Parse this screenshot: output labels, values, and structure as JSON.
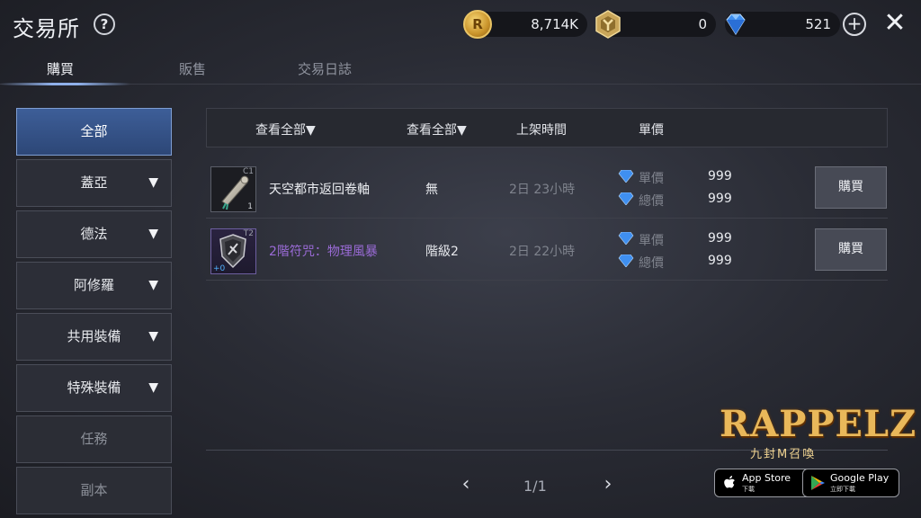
{
  "header": {
    "title": "交易所",
    "help_glyph": "?",
    "close_glyph": "✕",
    "plus_glyph": "+"
  },
  "currencies": [
    {
      "icon": "r-coin-icon",
      "value": "8,714K"
    },
    {
      "icon": "hex-badge-icon",
      "value": "0"
    },
    {
      "icon": "diamond-icon",
      "value": "521"
    }
  ],
  "tabs": [
    {
      "label": "購買",
      "active": true
    },
    {
      "label": "販售",
      "active": false
    },
    {
      "label": "交易日誌",
      "active": false
    }
  ],
  "sidebar": {
    "items": [
      {
        "label": "全部",
        "active": true,
        "expandable": false
      },
      {
        "label": "蓋亞",
        "active": false,
        "expandable": true
      },
      {
        "label": "德法",
        "active": false,
        "expandable": true
      },
      {
        "label": "阿修羅",
        "active": false,
        "expandable": true
      },
      {
        "label": "共用裝備",
        "active": false,
        "expandable": true
      },
      {
        "label": "特殊裝備",
        "active": false,
        "expandable": true
      },
      {
        "label": "任務",
        "active": false,
        "expandable": false
      },
      {
        "label": "副本",
        "active": false,
        "expandable": false
      }
    ],
    "tri_glyph": "▼"
  },
  "table": {
    "headers": {
      "filter1": "查看全部▼",
      "filter2": "查看全部▼",
      "listed_time": "上架時間",
      "unit_price": "單價"
    },
    "rows": [
      {
        "icon_top_right": "C1",
        "icon_bottom_right": "1",
        "icon_bottom_left": "",
        "name": "天空都市返回卷軸",
        "grade": "無",
        "time": "2日 23小時",
        "unit_label": "單價",
        "unit_value": "999",
        "total_label": "總價",
        "total_value": "999",
        "buy_label": "購買"
      },
      {
        "icon_top_right": "T2",
        "icon_bottom_right": "",
        "icon_bottom_left": "+0",
        "name": "2階符咒：物理風暴",
        "grade": "階級2",
        "time": "2日 22小時",
        "unit_label": "單價",
        "unit_value": "999",
        "total_label": "總價",
        "total_value": "999",
        "buy_label": "購買"
      }
    ]
  },
  "pager": {
    "current": "1/1",
    "prev_glyph": "‹",
    "next_glyph": "›"
  },
  "branding": {
    "logo": "RAPPELZ",
    "logo_sub": "九封M召喚",
    "app_store": {
      "main": "App Store",
      "sub": "下載"
    },
    "google_play": {
      "main": "Google Play",
      "sub": "立即下載"
    }
  },
  "colors": {
    "accent_blue": "#3d5e98",
    "item_purple": "#9a6bd6",
    "gem_blue": "#3f8ff0",
    "gold": "#e9b85a"
  }
}
